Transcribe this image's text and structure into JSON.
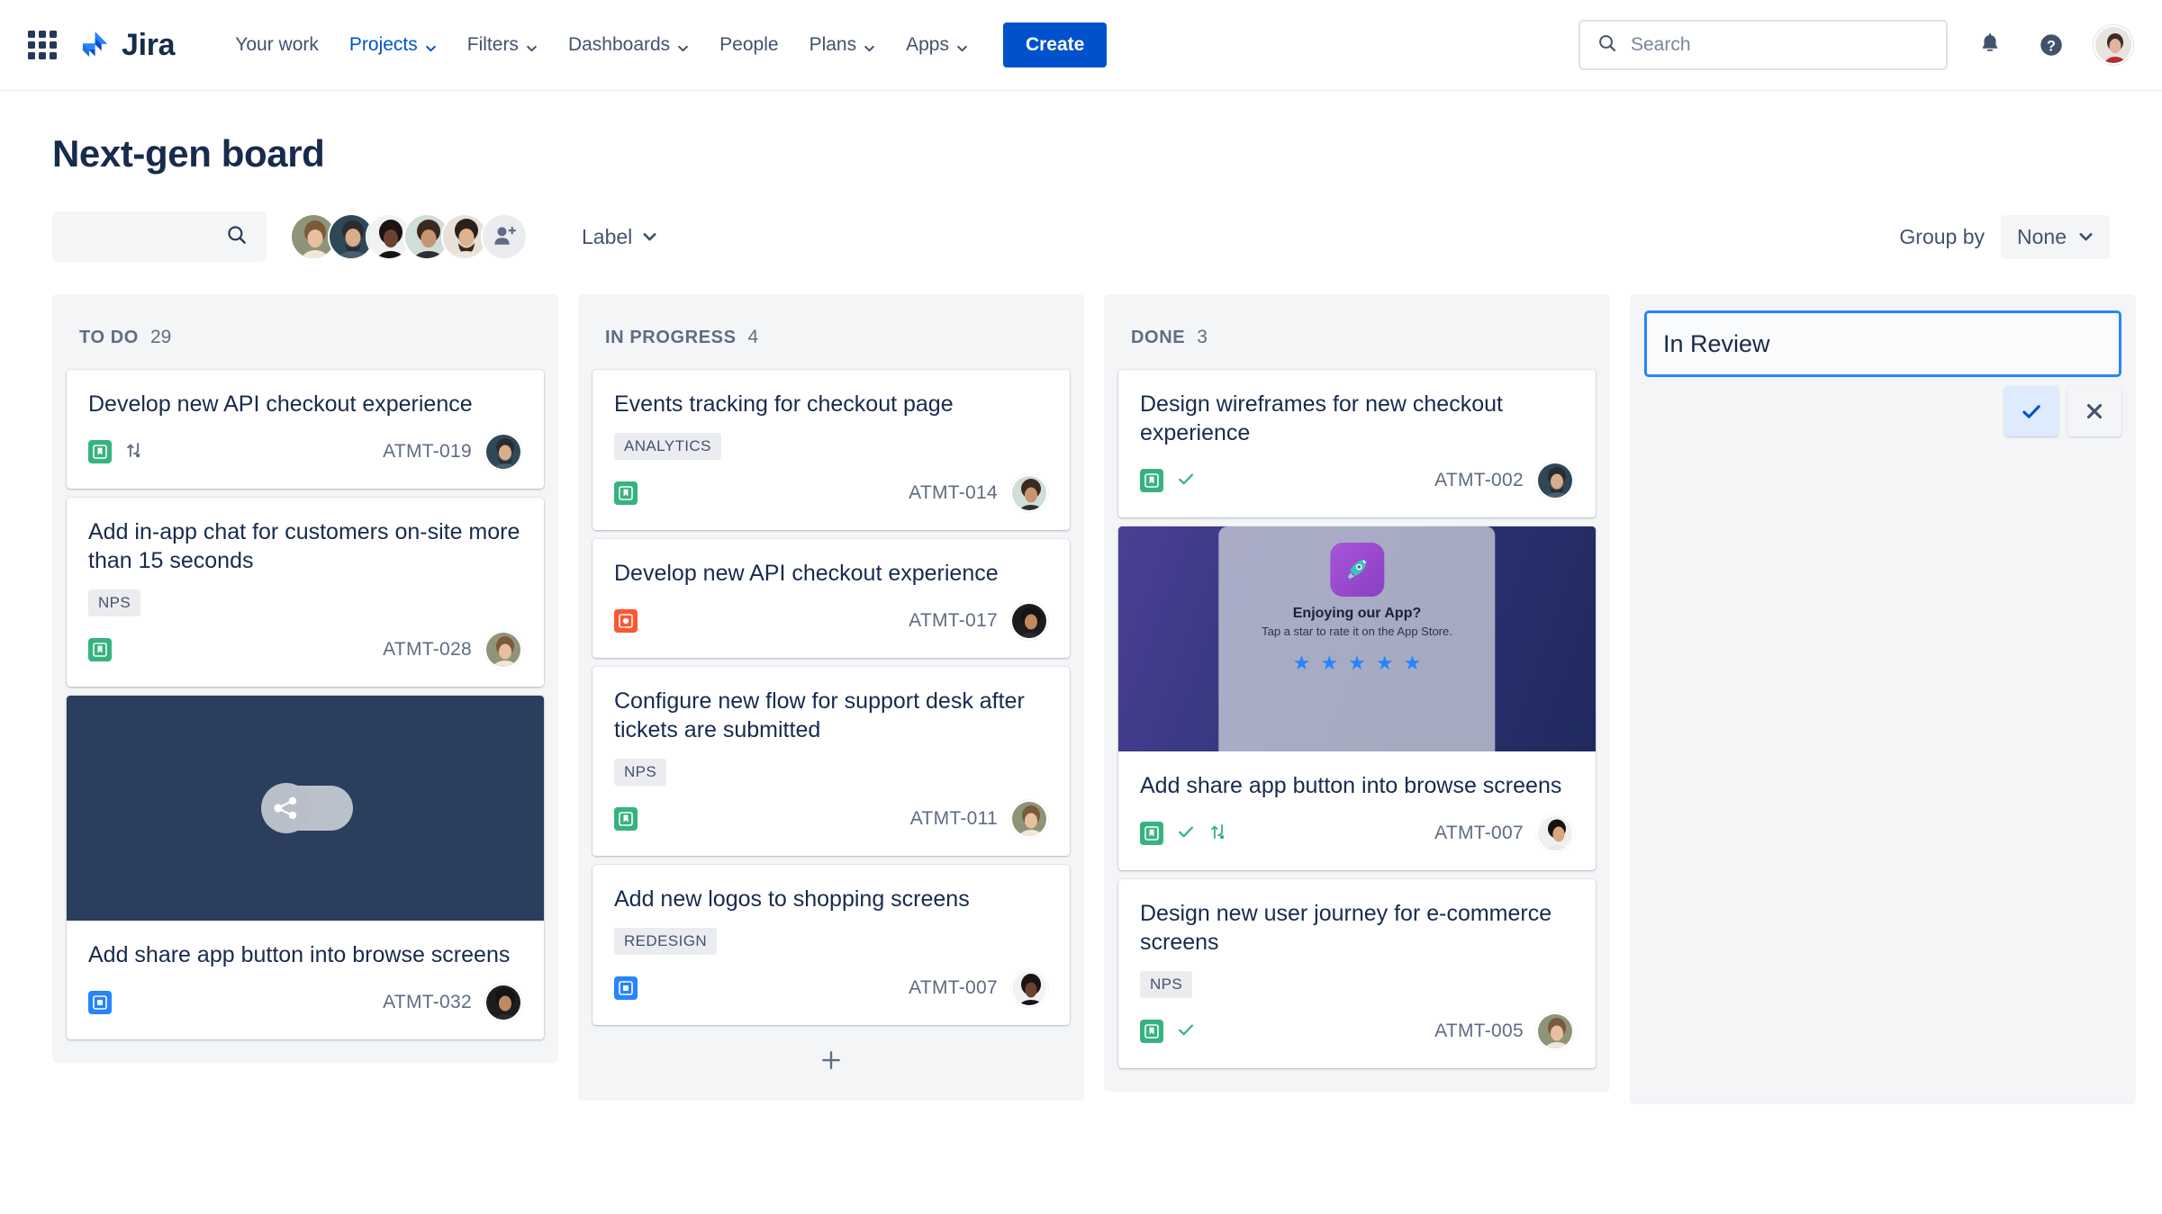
{
  "nav": {
    "brand": "Jira",
    "apps_switcher": "app-switcher",
    "links": [
      {
        "label": "Your work",
        "has_chevron": false,
        "active": false
      },
      {
        "label": "Projects",
        "has_chevron": true,
        "active": true
      },
      {
        "label": "Filters",
        "has_chevron": true,
        "active": false
      },
      {
        "label": "Dashboards",
        "has_chevron": true,
        "active": false
      },
      {
        "label": "People",
        "has_chevron": false,
        "active": false
      },
      {
        "label": "Plans",
        "has_chevron": true,
        "active": false
      },
      {
        "label": "Apps",
        "has_chevron": true,
        "active": false
      }
    ],
    "create_label": "Create",
    "search_placeholder": "Search",
    "notifications_icon": "bell-icon",
    "help_icon": "help-icon",
    "profile_icon": "profile-avatar"
  },
  "board": {
    "title": "Next-gen board",
    "search_value": "",
    "search_placeholder": "",
    "label_filter": "Label",
    "group_by_label": "Group by",
    "group_by_value": "None",
    "member_count": 5,
    "add_person_label": "Add people"
  },
  "colors": {
    "brand_blue": "#0052cc",
    "accent_blue": "#2684ff",
    "story_green": "#36b37e",
    "task_blue": "#2684ff",
    "bug_red": "#ff5630",
    "column_bg": "#f4f5f7",
    "text_dark": "#172b4d",
    "text_muted": "#5e6c84"
  },
  "columns": [
    {
      "name": "TO DO",
      "count": "29",
      "cards": [
        {
          "title": "Develop new API checkout experience",
          "tags": [],
          "type": "story",
          "type_icon": "story-bookmark-icon",
          "flags": [
            "branch-icon"
          ],
          "key": "ATMT-019",
          "avatar": "m1"
        },
        {
          "title": "Add in-app chat for customers on-site more than 15 seconds",
          "tags": [
            "NPS"
          ],
          "type": "story",
          "type_icon": "story-bookmark-icon",
          "flags": [],
          "key": "ATMT-028",
          "avatar": "f1"
        },
        {
          "title": "Add share app button into browse screens",
          "tags": [],
          "type": "task",
          "type_icon": "task-square-icon",
          "flags": [],
          "key": "ATMT-032",
          "avatar": "m3",
          "cover": "toggle-share-dark"
        }
      ]
    },
    {
      "name": "IN PROGRESS",
      "count": "4",
      "cards": [
        {
          "title": "Events tracking for checkout page",
          "tags": [
            "ANALYTICS"
          ],
          "type": "story",
          "type_icon": "story-bookmark-icon",
          "flags": [],
          "key": "ATMT-014",
          "avatar": "f2"
        },
        {
          "title": "Develop new API checkout experience",
          "tags": [],
          "type": "bug",
          "type_icon": "bug-circle-icon",
          "flags": [],
          "key": "ATMT-017",
          "avatar": "m3"
        },
        {
          "title": "Configure new flow for support desk after tickets are submitted",
          "tags": [
            "NPS"
          ],
          "type": "story",
          "type_icon": "story-bookmark-icon",
          "flags": [],
          "key": "ATMT-011",
          "avatar": "f1"
        },
        {
          "title": "Add new logos to shopping screens",
          "tags": [
            "REDESIGN"
          ],
          "type": "task",
          "type_icon": "task-square-icon",
          "flags": [],
          "key": "ATMT-007",
          "avatar": "f3"
        }
      ],
      "add_card_icon": "plus-icon"
    },
    {
      "name": "DONE",
      "count": "3",
      "cards": [
        {
          "title": "Design wireframes for new checkout experience",
          "tags": [],
          "type": "story",
          "type_icon": "story-bookmark-icon",
          "flags": [
            "check-icon"
          ],
          "key": "ATMT-002",
          "avatar": "m1"
        },
        {
          "title": "Add share app button into browse screens",
          "tags": [],
          "type": "story",
          "type_icon": "story-bookmark-icon",
          "flags": [
            "check-icon",
            "branch-icon"
          ],
          "key": "ATMT-007",
          "avatar": "m4",
          "cover": "app-rating-space"
        },
        {
          "title": "Design new user journey for e-commerce screens",
          "tags": [
            "NPS"
          ],
          "type": "story",
          "type_icon": "story-bookmark-icon",
          "flags": [
            "check-icon"
          ],
          "key": "ATMT-005",
          "avatar": "f1"
        }
      ]
    }
  ],
  "new_column": {
    "value": "In Review",
    "confirm_icon": "check-icon",
    "cancel_icon": "close-icon"
  },
  "cover_art": {
    "app_rating": {
      "headline": "Enjoying our App?",
      "subtext": "Tap a star to rate it on the App Store.",
      "stars": 5,
      "app_icon": "rocket-icon"
    },
    "toggle_share": {
      "icon": "share-toggle-icon"
    }
  }
}
